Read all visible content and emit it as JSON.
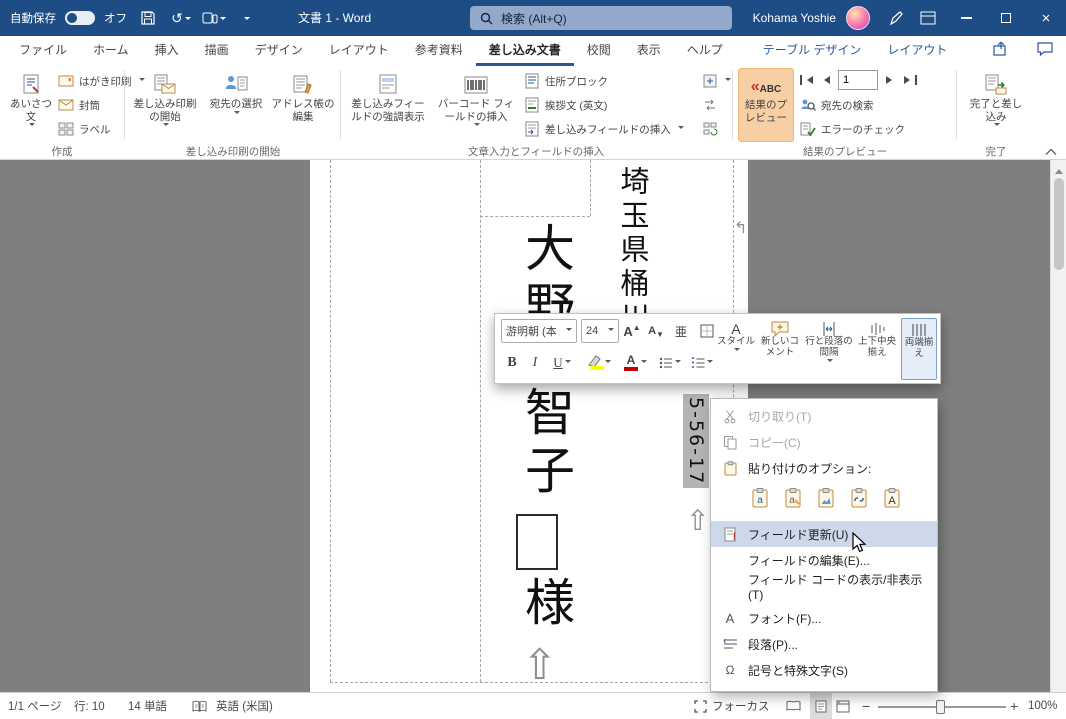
{
  "colors": {
    "titlebar": "#1e4c85",
    "accent": "#2b579a",
    "ribbon_toggle_active": "#f8cfa4",
    "menu_highlight": "#cdd8ea",
    "selection_gray": "#b4b4b4",
    "canvas_gray": "#7f7f7f"
  },
  "icons": {
    "undo": "↺",
    "close": "×",
    "zoom_out": "−",
    "zoom_in": "+",
    "vertical_paragraph_mark": "⇧",
    "return_mark": "↰",
    "preview_mark": "«",
    "abc": "ABC",
    "ruby": "亜",
    "font_letter": "A",
    "omega": "Ω"
  },
  "titlebar": {
    "autosave_label": "自動保存",
    "autosave_state": "オフ",
    "doc_title": "文書 1 - Word",
    "search_placeholder": "検索 (Alt+Q)",
    "user_name": "Kohama Yoshie"
  },
  "tabs": [
    "ファイル",
    "ホーム",
    "挿入",
    "描画",
    "デザイン",
    "レイアウト",
    "参考資料",
    "差し込み文書",
    "校閲",
    "表示",
    "ヘルプ",
    "テーブル デザイン",
    "レイアウト"
  ],
  "ribbon": {
    "group_labels": [
      "作成",
      "差し込み印刷の開始",
      "文章入力とフィールドの挿入",
      "結果のプレビュー",
      "完了"
    ],
    "create": {
      "greeting": "あいさつ文",
      "hagaki": "はがき印刷",
      "envelope": "封筒",
      "labels": "ラベル"
    },
    "start_group": {
      "start": "差し込み印刷の開始",
      "select": "宛先の選択",
      "edit": "アドレス帳の編集"
    },
    "write_group": {
      "highlight": "差し込みフィールドの強調表示",
      "barcode": "バーコード フィールドの挿入",
      "address": "住所ブロック",
      "greeting_en": "挨拶文 (英文)",
      "insert": "差し込みフィールドの挿入"
    },
    "preview_group": {
      "preview": "結果のプレビュー",
      "record": "1",
      "find": "宛先の検索",
      "check": "エラーのチェック"
    },
    "finish_group": {
      "finish": "完了と差し込み"
    }
  },
  "mini_toolbar": {
    "font_name": "游明朝 (本",
    "font_size": "24",
    "bold": "B",
    "italic": "I",
    "underline": "U",
    "styles": "スタイル",
    "new_comment": "新しいコメント",
    "line_spacing": "行と段落の間隔",
    "valign": "上下中央揃え",
    "justify": "両端揃え"
  },
  "context_menu": {
    "cut": "切り取り(T)",
    "copy": "コピー(C)",
    "paste_options": "貼り付けのオプション:",
    "update_field": "フィールド更新(U)",
    "edit_field": "フィールドの編集(E)...",
    "toggle_field_codes": "フィールド コードの表示/非表示(T)",
    "font": "フォント(F)...",
    "paragraph": "段落(P)...",
    "symbol": "記号と特殊文字(S)"
  },
  "document": {
    "address": "埼玉県桶川",
    "name_top": "大野",
    "name_bottom": "智子",
    "honorific": "様",
    "number": "5-56-17"
  },
  "statusbar": {
    "page": "1/1 ページ",
    "line": "行: 10",
    "words": "14 単語",
    "language": "英語 (米国)",
    "focus": "フォーカス",
    "zoom": "100%"
  }
}
